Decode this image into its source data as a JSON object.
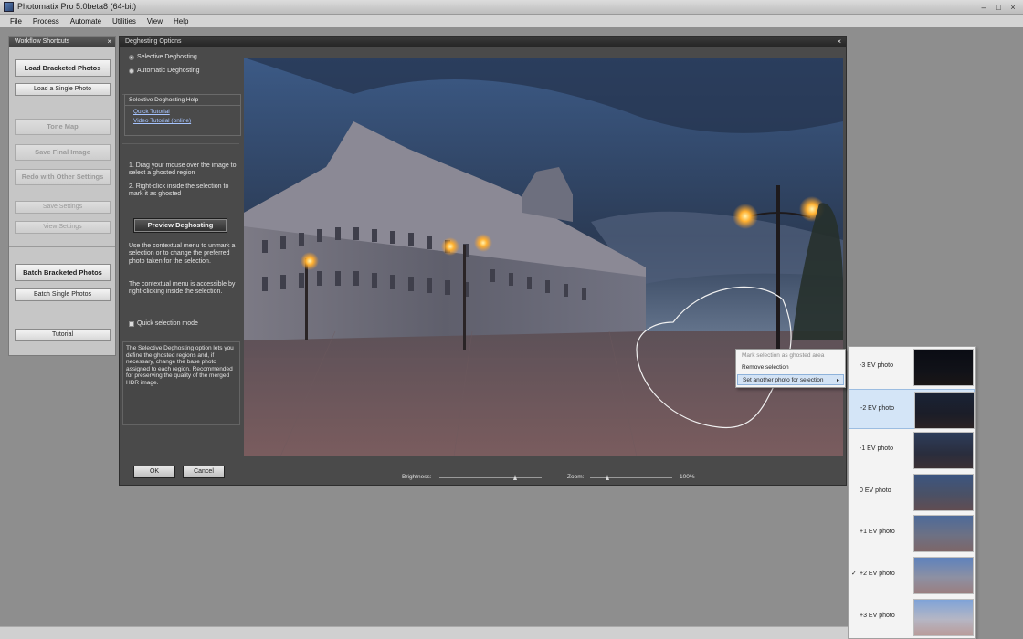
{
  "app": {
    "title": "Photomatix Pro 5.0beta8 (64-bit)"
  },
  "window_controls": {
    "min": "–",
    "max": "□",
    "close": "×"
  },
  "menu": [
    "File",
    "Process",
    "Automate",
    "Utilities",
    "View",
    "Help"
  ],
  "workflow": {
    "title": "Workflow Shortcuts",
    "buttons": {
      "load_bracketed": "Load Bracketed Photos",
      "load_single": "Load a Single Photo",
      "tone_map": "Tone Map",
      "save_final": "Save Final Image",
      "redo": "Redo with Other Settings",
      "save_settings": "Save Settings",
      "view_settings": "View Settings",
      "batch_bracketed": "Batch Bracketed Photos",
      "batch_single": "Batch Single Photos",
      "tutorial": "Tutorial"
    }
  },
  "deghosting": {
    "title": "Deghosting Options",
    "close": "×",
    "mode_selective": "Selective Deghosting",
    "mode_automatic": "Automatic Deghosting",
    "help_title": "Selective Deghosting Help",
    "help_links": [
      "Quick Tutorial",
      "Video Tutorial (online)"
    ],
    "instructions": [
      "1. Drag your  mouse over the image to select a ghosted region",
      "2. Right-click inside the selection to mark it as ghosted"
    ],
    "preview_button": "Preview Deghosting",
    "context_help": [
      "Use the contextual menu to unmark a selection or to change the preferred photo taken for the selection.",
      "The contextual menu is accessible by right-clicking inside the selection."
    ],
    "quick_selection": "Quick selection mode",
    "info": "The Selective Deghosting option lets you define the ghosted regions and, if necessary, change the base photo assigned to each region. Recommended for preserving the quality of the merged HDR image.",
    "ok": "OK",
    "cancel": "Cancel",
    "brightness_label": "Brightness:",
    "zoom_label": "Zoom:",
    "zoom_value": "100%"
  },
  "context_menu": {
    "items": [
      "Mark selection as ghosted area",
      "Remove selection",
      "Set another photo for selection"
    ],
    "submenu_arrow": "▸"
  },
  "photo_menu": {
    "items": [
      "-3 EV photo",
      "-2 EV photo",
      "-1 EV photo",
      "0 EV photo",
      "+1 EV photo",
      "+2 EV photo",
      "+3 EV photo"
    ],
    "highlighted": "-2 EV photo",
    "checked": "+2 EV photo",
    "check_glyph": "✓"
  },
  "colors": {
    "accent_highlight": "#d4e5f7",
    "link": "#a6c4ff",
    "panel_dark": "#4a4a4a"
  }
}
